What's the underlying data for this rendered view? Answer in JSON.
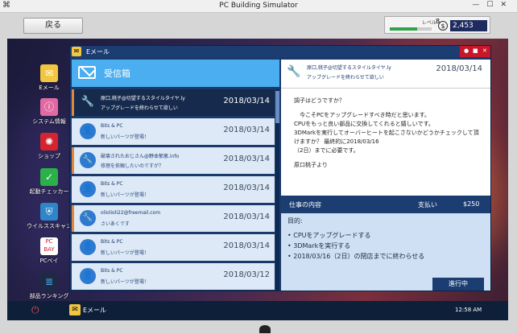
{
  "app": {
    "title": "PC Building Simulator",
    "back_label": "戻る"
  },
  "status": {
    "level_label": "レベル",
    "level": "8",
    "level_progress": 0.65,
    "money_symbol": "$",
    "money": "2,453"
  },
  "desktop_icons": [
    {
      "label": "Eメール",
      "icon": "mail-icon",
      "color": "#f3c640"
    },
    {
      "label": "システム情報",
      "icon": "system-info-icon",
      "color": "#e26aa3"
    },
    {
      "label": "ショップ",
      "icon": "shop-icon",
      "color": "#d3242f"
    },
    {
      "label": "起動チェッカー",
      "icon": "boot-checker-icon",
      "color": "#2bb04a"
    },
    {
      "label": "ウイルススキャン",
      "icon": "virus-scan-icon",
      "color": "#2e86c8"
    },
    {
      "label": "PCベイ",
      "icon": "pcbay-icon",
      "color": "#ffffff"
    },
    {
      "label": "部品ランキング",
      "icon": "ranking-icon",
      "color": "#1e2a44"
    }
  ],
  "taskbar": {
    "app_label": "Eメール",
    "clock": "12:58 AM"
  },
  "email": {
    "window_title": "Eメール",
    "inbox_title": "受信箱",
    "messages": [
      {
        "sender": "原口,桃子@切望するスタイルタイヤ.ly",
        "subject": "アップグレードを終わらせて欲しい",
        "date": "2018/03/14",
        "selected": true,
        "avatar": "wrench-icon"
      },
      {
        "sender": "Bits & PC",
        "subject": "新しいパーツが登場！",
        "date": "2018/03/14",
        "selected": false,
        "avatar": "person-icon"
      },
      {
        "sender": "破壊されたおじさん@野本郁恵.info",
        "subject": "修理を依頼したいのですが？",
        "date": "2018/03/14",
        "selected": false,
        "avatar": "wrench-icon"
      },
      {
        "sender": "Bits & PC",
        "subject": "新しいパーツが登場！",
        "date": "2018/03/14",
        "selected": false,
        "avatar": "person-icon"
      },
      {
        "sender": "oliolioli22@freemail.com",
        "subject": "さいあくです",
        "date": "2018/03/14",
        "selected": false,
        "avatar": "wrench-icon"
      },
      {
        "sender": "Bits & PC",
        "subject": "新しいパーツが登場！",
        "date": "2018/03/14",
        "selected": false,
        "avatar": "person-icon"
      },
      {
        "sender": "Bits & PC",
        "subject": "新しいパーツが登場！",
        "date": "2018/03/12",
        "selected": false,
        "avatar": "person-icon"
      }
    ],
    "reader": {
      "sender": "原口,桃子@切望するスタイルタイヤ.ly",
      "subject": "アップグレードを終わらせて欲しい",
      "date": "2018/03/14",
      "greeting": "調子はどうですか？",
      "body": [
        "今こそPCをアップグレードすべき時だと思います。",
        "CPUをもっと良い部品に交換してくれると嬉しいです。",
        "3DMarkを実行してオーバーヒートを起こさないかどうかチェックして頂けますか？ 最終的に2018/03/16",
        "（2日）までに必要です。"
      ],
      "signature": "原口桃子より"
    },
    "job": {
      "heading": "仕事の内容",
      "payment_label": "支払い",
      "payment": "$250",
      "goal_label": "目的:",
      "goals": [
        "CPUをアップグレードする",
        "3DMarkを実行する",
        "2018/03/16（2日）の閉店までに終わらせる"
      ],
      "status": "進行中"
    }
  }
}
